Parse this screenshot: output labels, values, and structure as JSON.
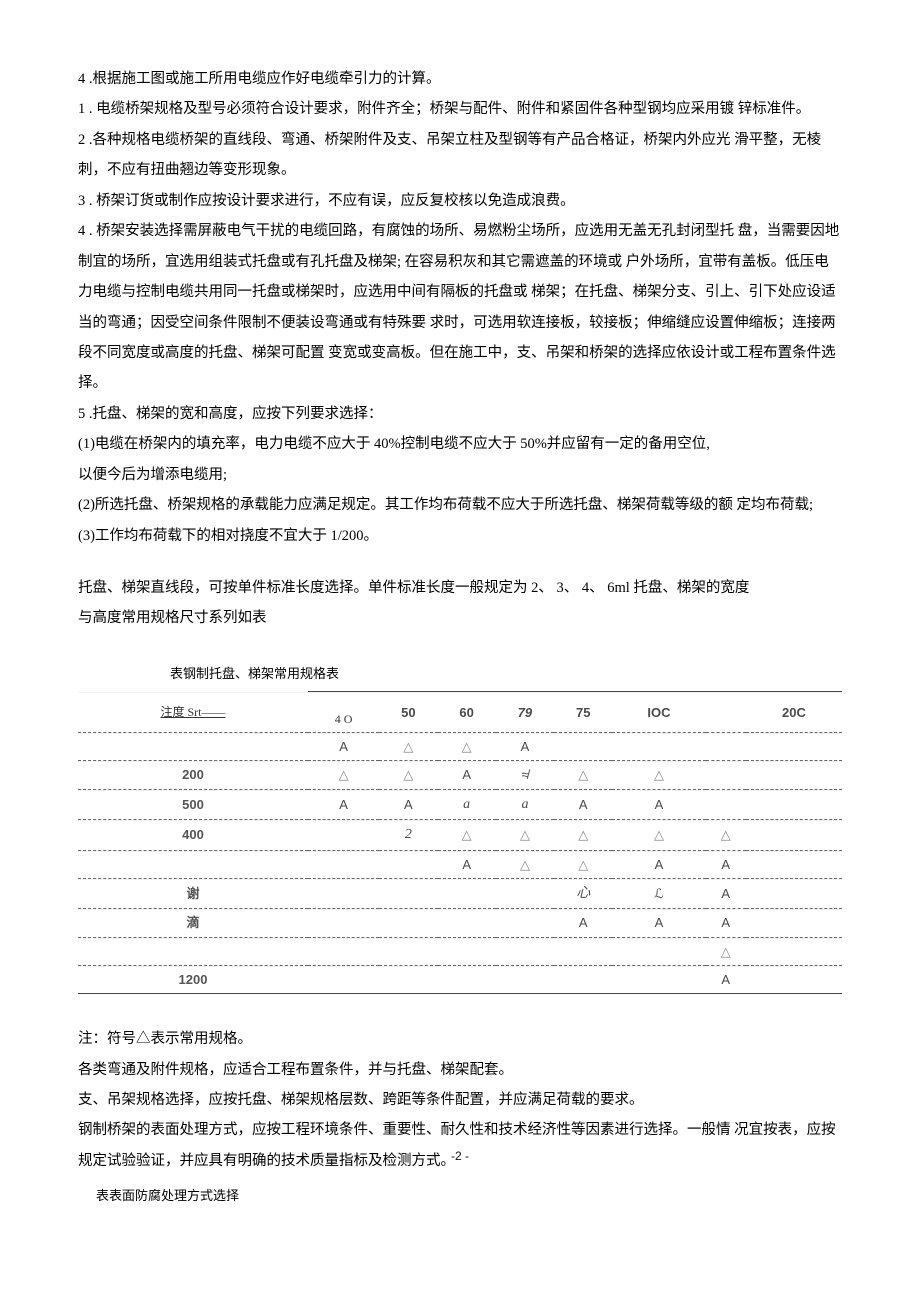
{
  "paragraphs": {
    "p1": "4 .根据施工图或施工所用电缆应作好电缆牵引力的计算。",
    "p2": "1 . 电缆桥架规格及型号必须符合设计要求，附件齐全；桥架与配件、附件和紧固件各种型钢均应采用镀  锌标准件。",
    "p3": "2 .各种规格电缆桥架的直线段、弯通、桥架附件及支、吊架立柱及型钢等有产品合格证，桥架内外应光 滑平整，无棱刺，不应有扭曲翘边等变形现象。",
    "p4": "3 . 桥架订货或制作应按设计要求进行，不应有误，应反复校核以免造成浪费。",
    "p5": "4 . 桥架安装选择需屏蔽电气干扰的电缆回路，有腐蚀的场所、易燃粉尘场所，应选用无盖无孔封闭型托  盘，当需要因地制宜的场所，宜选用组装式托盘或有孔托盘及梯架; 在容易积灰和其它需遮盖的环境或  户外场所，宜带有盖板。低压电力电缆与控制电缆共用同一托盘或梯架时，应选用中间有隔板的托盘或 梯架；在托盘、梯架分支、引上、引下处应设适当的弯通；因受空间条件限制不便装设弯通或有特殊要 求时，可选用软连接板，较接板；伸缩缝应设置伸缩板；连接两段不同宽度或高度的托盘、梯架可配置 变宽或变高板。但在施工中，支、吊架和桥架的选择应依设计或工程布置条件选择。",
    "p6": "5 .托盘、梯架的宽和高度，应按下列要求选择：",
    "p7": "(1)电缆在桥架内的填充率，电力电缆不应大于 40%控制电缆不应大于  50%并应留有一定的备用空位,",
    "p8": "以便今后为增添电缆用;",
    "p9": "(2)所选托盘、桥架规格的承载能力应满足规定。其工作均布荷载不应大于所选托盘、梯架荷载等级的额  定均布荷载;",
    "p10": "(3)工作均布荷载下的相对挠度不宜大于 1/200。",
    "p11": "托盘、梯架直线段，可按单件标准长度选择。单件标准长度一般规定为 2、 3、 4、 6ml 托盘、梯架的宽度",
    "p12": "与高度常用规格尺寸系列如表"
  },
  "table": {
    "caption": "表钢制托盘、梯架常用规格表",
    "header_left": "注度 Srt——",
    "cols": [
      "4 O",
      "50",
      "60",
      "79",
      "75",
      "IOC",
      "",
      "20C"
    ],
    "rows": [
      {
        "label": "",
        "cells": [
          "A",
          "△",
          "△",
          "A",
          "",
          "",
          "",
          ""
        ]
      },
      {
        "label": "200",
        "cells": [
          "△",
          "△",
          "A",
          "≉",
          "△",
          "△",
          "",
          ""
        ]
      },
      {
        "label": "500",
        "cells": [
          "A",
          "A",
          "a",
          "a",
          "A",
          "A",
          "",
          ""
        ]
      },
      {
        "label": "400",
        "cells": [
          "",
          "2",
          "△",
          "△",
          "△",
          "△",
          "△",
          ""
        ]
      },
      {
        "label": "",
        "cells": [
          "",
          "",
          "A",
          "△",
          "△",
          "A",
          "A",
          ""
        ]
      },
      {
        "label": "谢",
        "cells": [
          "",
          "",
          "",
          "",
          "心",
          "ℒ",
          "A",
          ""
        ]
      },
      {
        "label": "滴",
        "cells": [
          "",
          "",
          "",
          "",
          "A",
          "A",
          "A",
          ""
        ]
      },
      {
        "label": "",
        "cells": [
          "",
          "",
          "",
          "",
          "",
          "",
          "△",
          ""
        ]
      },
      {
        "label": "1200",
        "cells": [
          "",
          "",
          "",
          "",
          "",
          "",
          "A",
          ""
        ]
      }
    ]
  },
  "notes": {
    "n1": "注：符号△表示常用规格。",
    "n2": "各类弯通及附件规格，应适合工程布置条件，并与托盘、梯架配套。",
    "n3": "支、吊架规格选择，应按托盘、梯架规格层数、跨距等条件配置，并应满足荷载的要求。",
    "n4": "钢制桥架的表面处理方式，应按工程环境条件、重要性、耐久性和技术经济性等因素进行选择。一般情 况宜按表，应按规定试验验证，并应具有明确的技术质量指标及检测方式。",
    "n5": "表表面防腐处理方式选择"
  },
  "page_num": "-2 -"
}
